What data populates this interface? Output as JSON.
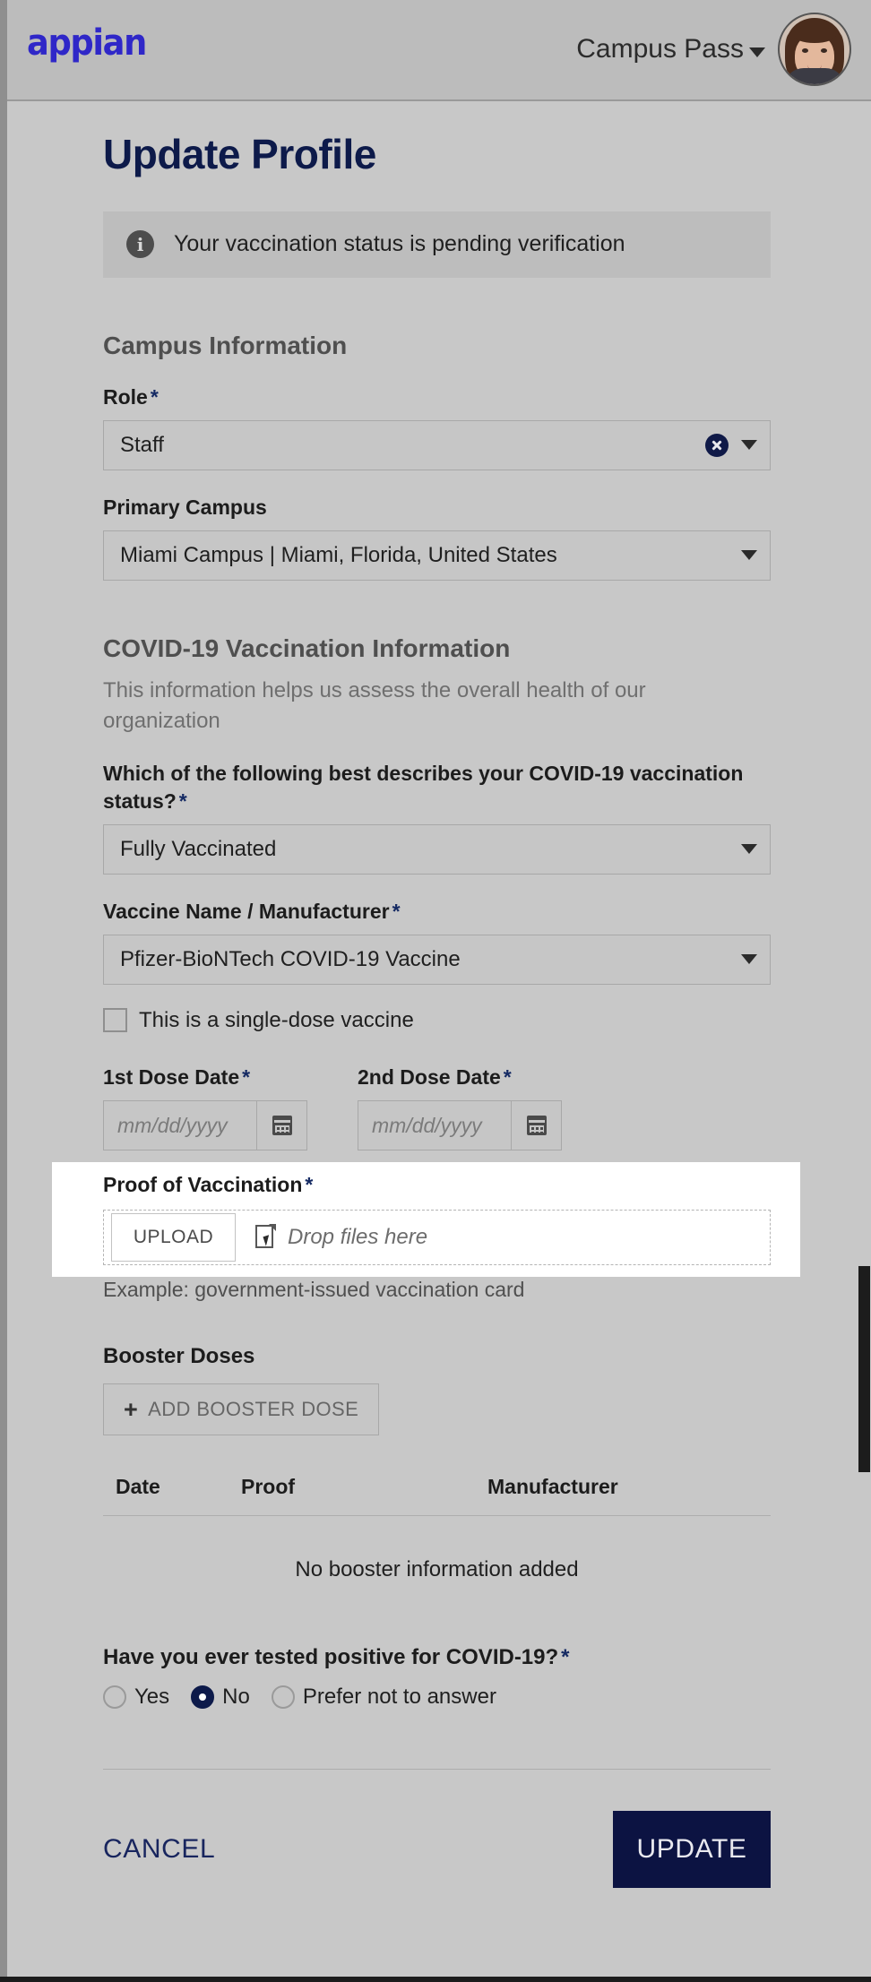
{
  "topbar": {
    "logo_text": "appian",
    "site_name": "Campus Pass",
    "avatar_name": "user-avatar"
  },
  "page": {
    "title": "Update Profile"
  },
  "banner": {
    "icon": "info-icon",
    "text": "Your vaccination status is pending verification"
  },
  "campus_section": {
    "heading": "Campus Information",
    "role": {
      "label": "Role",
      "required_mark": "*",
      "value": "Staff"
    },
    "primary_campus": {
      "label": "Primary Campus",
      "value": "Miami Campus | Miami, Florida, United States"
    }
  },
  "covid_section": {
    "heading": "COVID-19 Vaccination Information",
    "subtext": "This information helps us assess the overall health of our organization",
    "status": {
      "label": "Which of the following best describes your COVID-19 vaccination status?",
      "required_mark": "*",
      "value": "Fully Vaccinated"
    },
    "vaccine": {
      "label": "Vaccine Name / Manufacturer",
      "required_mark": "*",
      "value": "Pfizer-BioNTech COVID-19 Vaccine"
    },
    "single_dose_checkbox": {
      "label": "This is a single-dose vaccine",
      "checked": false
    },
    "dose1": {
      "label": "1st Dose Date",
      "required_mark": "*",
      "value": "",
      "placeholder": "mm/dd/yyyy"
    },
    "dose2": {
      "label": "2nd Dose Date",
      "required_mark": "*",
      "value": "",
      "placeholder": "mm/dd/yyyy"
    }
  },
  "proof_section": {
    "label": "Proof of Vaccination",
    "required_mark": "*",
    "upload_button": "UPLOAD",
    "drop_text": "Drop files here",
    "hint": "Example: government-issued vaccination card"
  },
  "booster_section": {
    "heading": "Booster Doses",
    "add_button": "ADD BOOSTER DOSE",
    "add_button_icon": "plus-icon",
    "columns": [
      "Date",
      "Proof",
      "Manufacturer"
    ],
    "rows": [],
    "empty_text": "No booster information added"
  },
  "tested_positive": {
    "label": "Have you ever tested positive for COVID-19?",
    "required_mark": "*",
    "options": [
      {
        "label": "Yes",
        "selected": false
      },
      {
        "label": "No",
        "selected": true
      },
      {
        "label": "Prefer not to answer",
        "selected": false
      }
    ]
  },
  "footer": {
    "cancel_label": "CANCEL",
    "update_label": "UPDATE"
  },
  "colors": {
    "brand_logo": "#2f27c8",
    "title_navy": "#0d1a4a",
    "primary_button": "#0c1342",
    "required_asterisk": "#152a63",
    "page_background": "#c8c8c8",
    "highlight_band": "#ffffff"
  }
}
